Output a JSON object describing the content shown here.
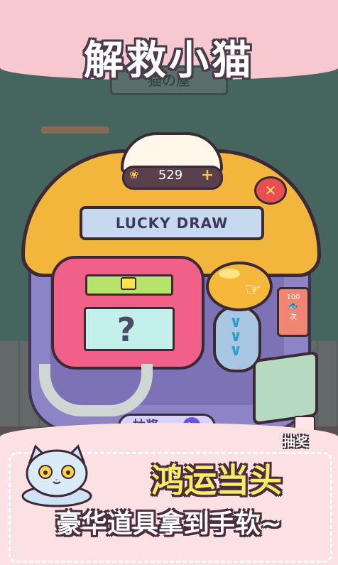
{
  "title": "解救小猫",
  "sign_text": "猫の屋",
  "machine": {
    "banner": "LUCKY DRAW",
    "coin_count": "529",
    "coin_plus": "+",
    "close_glyph": "✕",
    "question_mark": "?",
    "price_tag": {
      "amount": "100",
      "per": "次",
      "fish_glyph": "🐟"
    },
    "draw_button_label": "抽奖",
    "play_glyph": "▶"
  },
  "corner_label": "抽奖",
  "slogans": {
    "line1": "鸿运当头",
    "line2": "豪华道具拿到手软~"
  },
  "icons": {
    "coin": "fish-coin-icon",
    "close": "close-icon",
    "hand": "tap-hand-icon",
    "cat": "cat-mascot-icon"
  },
  "colors": {
    "dome": "#f3b63c",
    "body": "#8d84c5",
    "screen": "#f06088",
    "slogan_yellow": "#f6ec6a",
    "pink_band": "#f7c9cf"
  }
}
